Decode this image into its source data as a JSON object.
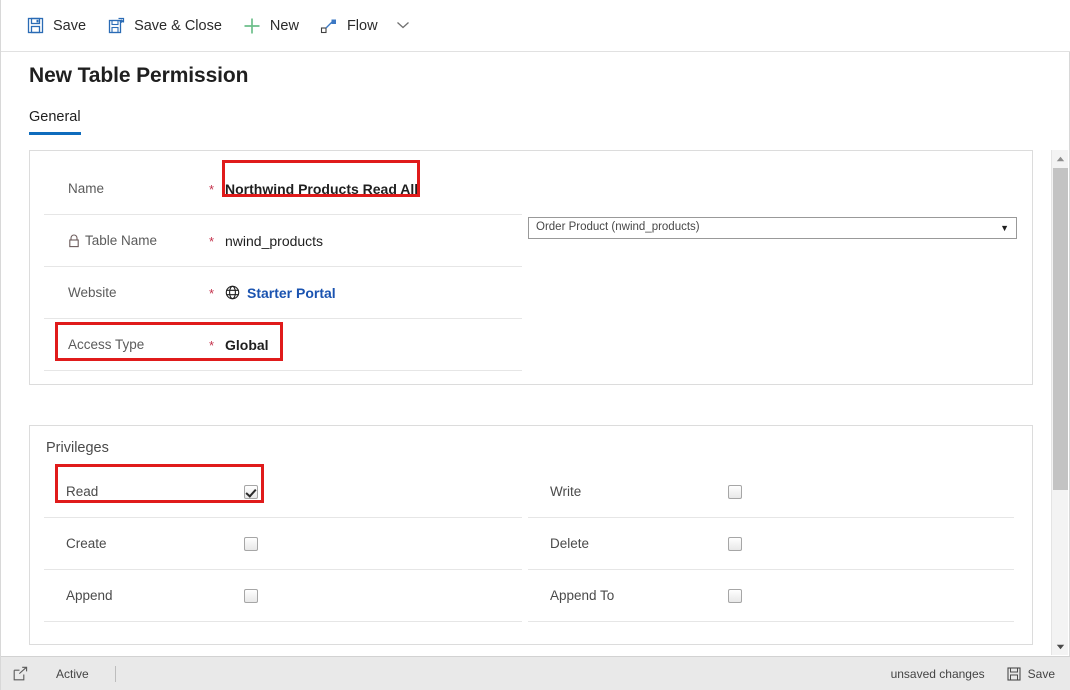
{
  "commandbar": {
    "buttons": [
      {
        "label": "Save",
        "icon": "save-icon"
      },
      {
        "label": "Save & Close",
        "icon": "save-and-close-icon"
      },
      {
        "label": "New",
        "icon": "plus-icon"
      },
      {
        "label": "Flow",
        "icon": "flow-icon"
      }
    ],
    "chevron_icon": "chevron-down-icon",
    "colors": {
      "save_icon": "#2a6bb5",
      "new_icon": "#6cbf8a",
      "flow_icon": "#3b78c4",
      "chevron": "#707070"
    }
  },
  "header": {
    "title": "New Table Permission",
    "tabs": [
      {
        "label": "General",
        "active": true
      }
    ],
    "accent": "#0f6cbd"
  },
  "general": {
    "fields": [
      {
        "label": "Name",
        "required": "*",
        "value": "Northwind Products Read All",
        "locked": false,
        "highlighted": true
      },
      {
        "label": "Table Name",
        "required": "*",
        "value": "nwind_products",
        "locked": true,
        "lock_icon": "lock-icon",
        "highlighted": false
      },
      {
        "label": "Website",
        "required": "*",
        "value": "Starter Portal",
        "is_link": true,
        "link_icon": "globe-icon",
        "locked": false,
        "highlighted": false
      },
      {
        "label": "Access Type",
        "required": "*",
        "value": "Global",
        "locked": false,
        "highlighted": true
      }
    ],
    "lookup": {
      "value": "Order Product (nwind_products)",
      "arrow_icon": "dropdown-arrow-icon"
    }
  },
  "privileges": {
    "heading": "Privileges",
    "left": [
      {
        "label": "Read",
        "checked": true,
        "highlighted": true
      },
      {
        "label": "Create",
        "checked": false,
        "highlighted": false
      },
      {
        "label": "Append",
        "checked": false,
        "highlighted": false
      }
    ],
    "right": [
      {
        "label": "Write",
        "checked": false,
        "highlighted": false
      },
      {
        "label": "Delete",
        "checked": false,
        "highlighted": false
      },
      {
        "label": "Append To",
        "checked": false,
        "highlighted": false
      }
    ]
  },
  "scrollbar": {
    "up_icon": "scroll-up-arrow-icon",
    "down_icon": "scroll-down-arrow-icon"
  },
  "statusbar": {
    "record_icon": "open-record-icon",
    "status": "Active",
    "unsaved": "unsaved changes",
    "save_label": "Save",
    "save_icon": "save-icon"
  },
  "highlight_color": "#e01b1b"
}
